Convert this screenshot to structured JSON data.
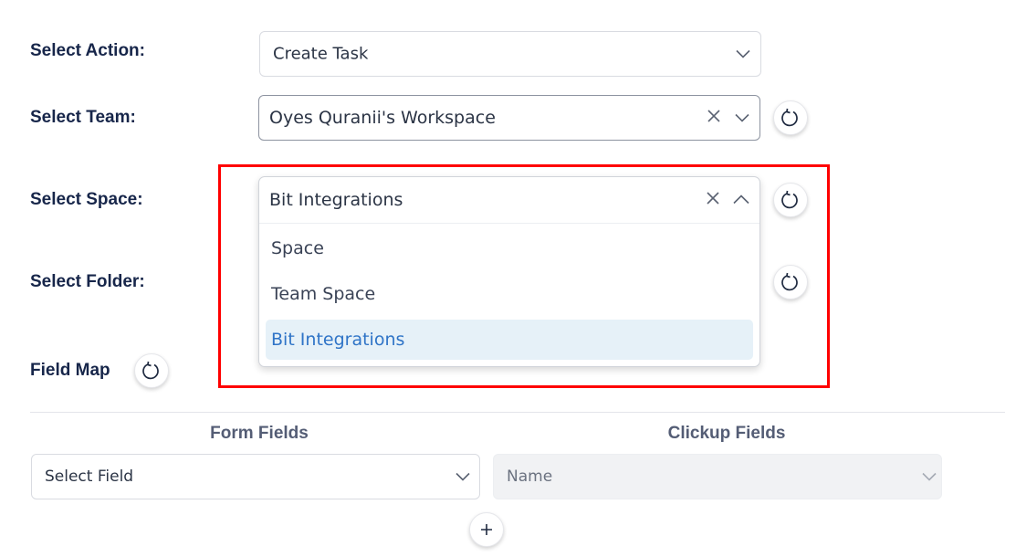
{
  "form": {
    "action": {
      "label": "Select Action:",
      "value": "Create Task"
    },
    "team": {
      "label": "Select Team:",
      "value": "Oyes Quranii's Workspace"
    },
    "space": {
      "label": "Select Space:",
      "value": "Bit Integrations",
      "options": [
        "Space",
        "Team Space",
        "Bit Integrations"
      ],
      "selected_option": "Bit Integrations"
    },
    "folder": {
      "label": "Select Folder:"
    }
  },
  "field_map": {
    "title": "Field Map",
    "col_form": "Form Fields",
    "col_clickup": "Clickup Fields",
    "rows": [
      {
        "form_field": "Select Field",
        "clickup_field": "Name"
      }
    ]
  },
  "icons": {
    "refresh": "refresh-icon",
    "clear": "close-icon",
    "chevron_down": "chevron-down-icon",
    "chevron_up": "chevron-up-icon",
    "add": "plus-icon"
  },
  "colors": {
    "highlight_box": "#ff0000",
    "selected_option_bg": "#e6f1f8",
    "selected_option_text": "#2f74c7",
    "label_text": "#17264a"
  }
}
